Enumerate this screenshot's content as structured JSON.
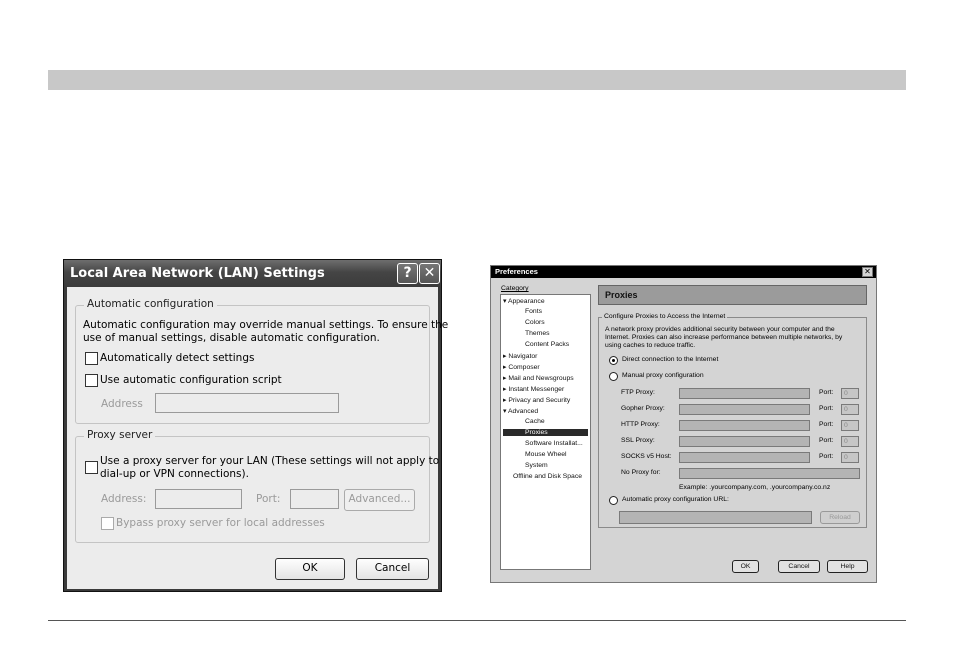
{
  "lan_dialog": {
    "title": "Local Area Network (LAN) Settings",
    "help_glyph": "?",
    "close_glyph": "✕",
    "auto_group": {
      "legend": "Automatic configuration",
      "description_line1": "Automatic configuration may override manual settings.  To ensure the",
      "description_line2": "use of manual settings, disable automatic configuration.",
      "detect_label": "Automatically detect settings",
      "script_label": "Use automatic configuration script",
      "address_label": "Address",
      "address_value": ""
    },
    "proxy_group": {
      "legend": "Proxy server",
      "use_proxy_line1": "Use a proxy server for your LAN (These settings will not apply to",
      "use_proxy_line2": "dial-up or VPN connections).",
      "address_label": "Address:",
      "address_value": "",
      "port_label": "Port:",
      "port_value": "",
      "advanced_label": "Advanced...",
      "bypass_label": "Bypass proxy server for local addresses"
    },
    "ok_label": "OK",
    "cancel_label": "Cancel"
  },
  "prefs_dialog": {
    "title": "Preferences",
    "close_glyph": "✕",
    "category_label": "Category",
    "tree": {
      "appearance": "Appearance",
      "fonts": "Fonts",
      "colors": "Colors",
      "themes": "Themes",
      "content_packs": "Content Packs",
      "navigator": "Navigator",
      "composer": "Composer",
      "mail": "Mail and Newsgroups",
      "instant_messenger": "Instant Messenger",
      "privacy": "Privacy and Security",
      "advanced": "Advanced",
      "cache": "Cache",
      "proxies": "Proxies",
      "software_install": "Software Installat...",
      "mouse_wheel": "Mouse Wheel",
      "system": "System",
      "offline": "Offline and Disk Space"
    },
    "panel_title": "Proxies",
    "group_legend": "Configure Proxies to Access the Internet",
    "description_line1": "A network proxy provides additional security between your computer and the",
    "description_line2": "Internet. Proxies can also increase performance between multiple networks, by",
    "description_line3": "using caches to reduce traffic.",
    "direct_label": "Direct connection to the Internet",
    "manual_label": "Manual proxy configuration",
    "ftp_label": "FTP Proxy:",
    "gopher_label": "Gopher Proxy:",
    "http_label": "HTTP Proxy:",
    "ssl_label": "SSL Proxy:",
    "socks_label": "SOCKS v5 Host:",
    "no_proxy_label": "No Proxy for:",
    "port_label": "Port:",
    "port_value": "0",
    "example_text": "Example: .yourcompany.com, .yourcompany.co.nz",
    "auto_url_label": "Automatic proxy configuration URL:",
    "reload_label": "Reload",
    "ok_label": "OK",
    "cancel_label": "Cancel",
    "help_label": "Help"
  }
}
